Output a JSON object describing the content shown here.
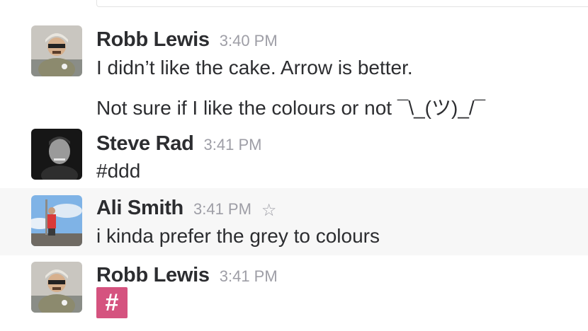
{
  "messages": [
    {
      "author": "Robb Lewis",
      "time": "3:40 PM",
      "lines": [
        "I didn’t like the cake. Arrow is better.",
        "Not sure if I like the colours or not ¯\\_(ツ)_/¯"
      ]
    },
    {
      "author": "Steve Rad",
      "time": "3:41 PM",
      "lines": [
        "#ddd"
      ]
    },
    {
      "author": "Ali Smith",
      "time": "3:41 PM",
      "lines": [
        "i kinda prefer the grey to colours"
      ],
      "star_icon": "star-outline-icon"
    },
    {
      "author": "Robb Lewis",
      "time": "3:41 PM",
      "emoji": {
        "glyph": "#",
        "name": "hash-emoji",
        "color": "#d5537f"
      }
    }
  ],
  "colors": {
    "text": "#2c2d30",
    "timestamp": "#9e9ea6",
    "hover_row": "#f7f7f7"
  }
}
